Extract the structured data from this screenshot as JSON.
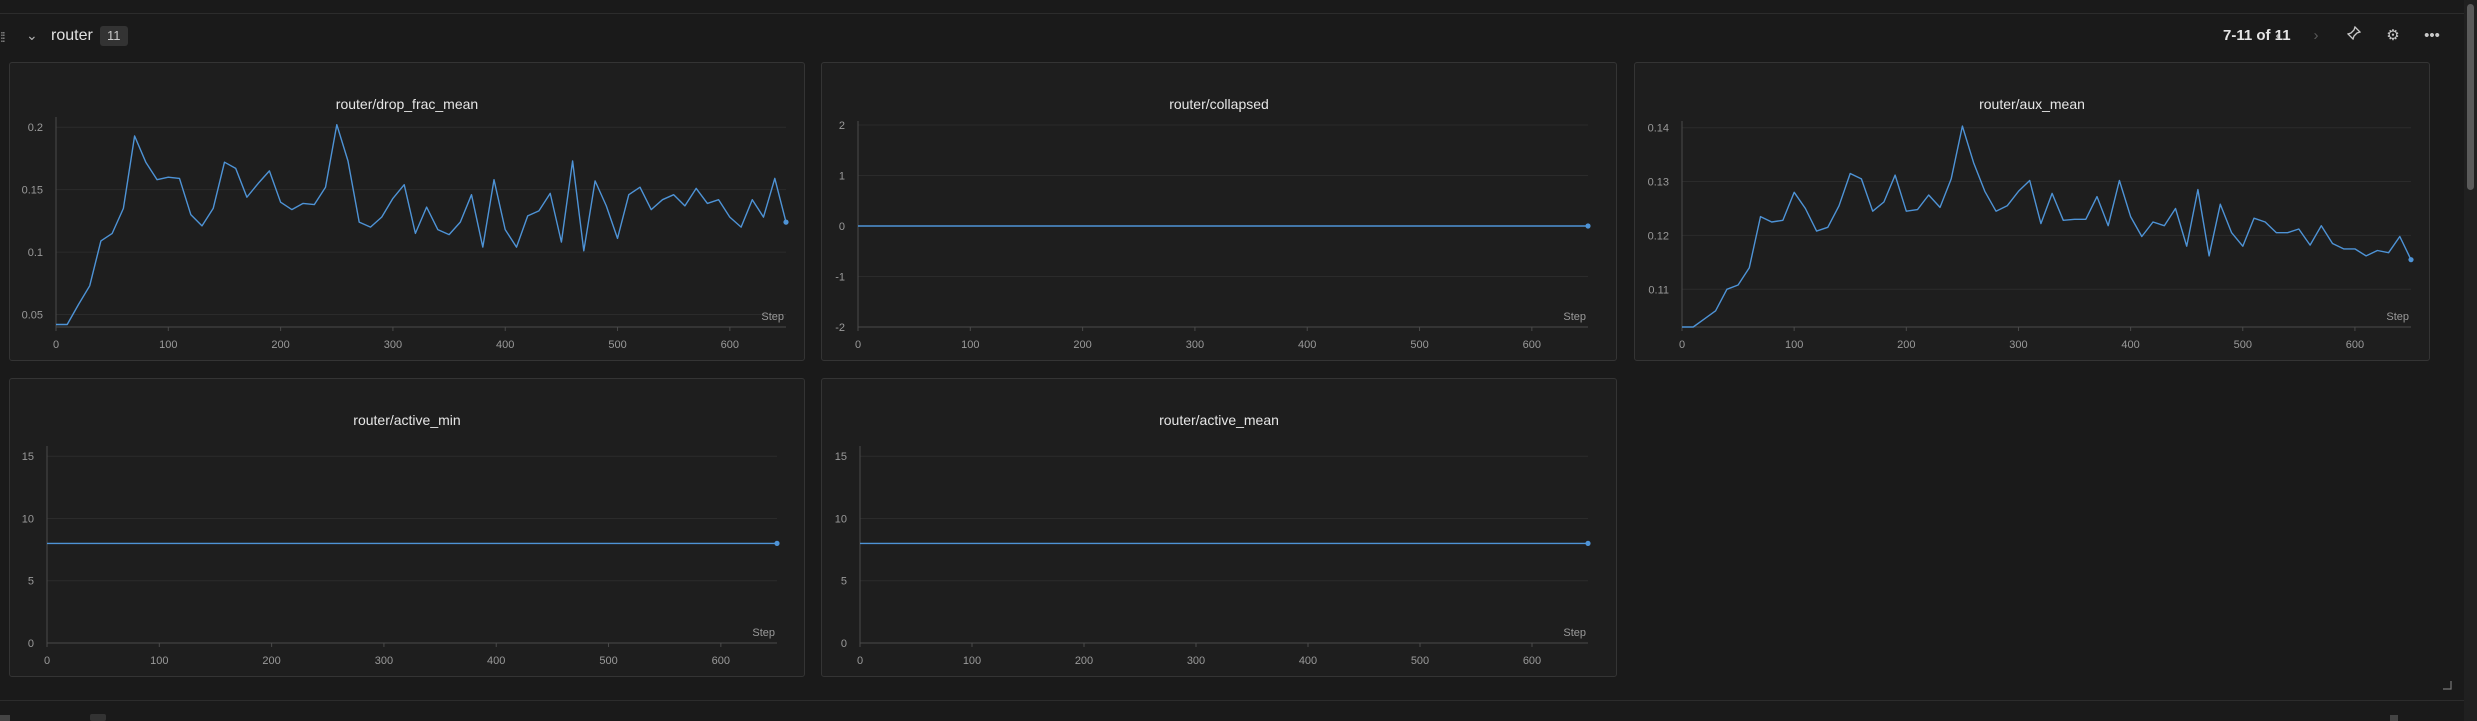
{
  "section": {
    "title": "router",
    "count": "11",
    "pager": "7-11 of 11"
  },
  "icons": {
    "drag": "drag-handle-icon",
    "collapse": "chevron-down-icon",
    "prev": "chevron-left-icon",
    "next": "chevron-right-icon",
    "pin": "pin-icon",
    "settings": "gear-icon",
    "more": "more-horizontal-icon",
    "resize": "resize-corner-icon"
  },
  "colors": {
    "line": "#4e93d6",
    "background": "#1a1a1a",
    "panel": "#1e1e1e",
    "grid": "#2b2b2b"
  },
  "chart_data": [
    {
      "type": "line",
      "title": "router/drop_frac_mean",
      "xlabel": "Step",
      "xlim": [
        0,
        650
      ],
      "ylim": [
        0.04,
        0.205
      ],
      "xticks": [
        0,
        100,
        200,
        300,
        400,
        500,
        600
      ],
      "yticks": [
        0.05,
        0.1,
        0.15,
        0.2
      ],
      "ytick_labels": [
        "0.05",
        "0.1",
        "0.15",
        "0.2"
      ],
      "grid": true,
      "end_marker": true,
      "x": [
        0,
        10,
        20,
        30,
        40,
        50,
        60,
        70,
        80,
        90,
        100,
        110,
        120,
        130,
        140,
        150,
        160,
        170,
        180,
        190,
        200,
        210,
        220,
        230,
        240,
        250,
        260,
        270,
        280,
        290,
        300,
        310,
        320,
        330,
        340,
        350,
        360,
        370,
        380,
        390,
        400,
        410,
        420,
        430,
        440,
        450,
        460,
        470,
        480,
        490,
        500,
        510,
        520,
        530,
        540,
        550,
        560,
        570,
        580,
        590,
        600,
        610,
        620,
        630,
        640,
        650
      ],
      "y": [
        0.042,
        0.042,
        0.058,
        0.073,
        0.109,
        0.115,
        0.135,
        0.193,
        0.172,
        0.158,
        0.16,
        0.159,
        0.13,
        0.121,
        0.135,
        0.172,
        0.167,
        0.144,
        0.155,
        0.165,
        0.14,
        0.134,
        0.139,
        0.138,
        0.152,
        0.202,
        0.173,
        0.124,
        0.12,
        0.128,
        0.143,
        0.154,
        0.115,
        0.136,
        0.118,
        0.114,
        0.124,
        0.146,
        0.104,
        0.158,
        0.118,
        0.104,
        0.129,
        0.133,
        0.147,
        0.108,
        0.173,
        0.101,
        0.157,
        0.137,
        0.111,
        0.146,
        0.152,
        0.134,
        0.142,
        0.146,
        0.137,
        0.151,
        0.139,
        0.142,
        0.128,
        0.12,
        0.142,
        0.128,
        0.159,
        0.124
      ]
    },
    {
      "type": "line",
      "title": "router/collapsed",
      "xlabel": "Step",
      "xlim": [
        0,
        650
      ],
      "ylim": [
        -2,
        2
      ],
      "xticks": [
        0,
        100,
        200,
        300,
        400,
        500,
        600
      ],
      "yticks": [
        -2,
        -1,
        0,
        1,
        2
      ],
      "ytick_labels": [
        "-2",
        "-1",
        "0",
        "1",
        "2"
      ],
      "grid": true,
      "end_marker": true,
      "x": [
        0,
        650
      ],
      "y": [
        0,
        0
      ]
    },
    {
      "type": "line",
      "title": "router/aux_mean",
      "xlabel": "Step",
      "xlim": [
        0,
        650
      ],
      "ylim": [
        0.103,
        0.1405
      ],
      "xticks": [
        0,
        100,
        200,
        300,
        400,
        500,
        600
      ],
      "yticks": [
        0.11,
        0.12,
        0.13,
        0.14
      ],
      "ytick_labels": [
        "0.11",
        "0.12",
        "0.13",
        "0.14"
      ],
      "grid": true,
      "end_marker": true,
      "x": [
        0,
        10,
        20,
        30,
        40,
        50,
        60,
        70,
        80,
        90,
        100,
        110,
        120,
        130,
        140,
        150,
        160,
        170,
        180,
        190,
        200,
        210,
        220,
        230,
        240,
        250,
        260,
        270,
        280,
        290,
        300,
        310,
        320,
        330,
        340,
        350,
        360,
        370,
        380,
        390,
        400,
        410,
        420,
        430,
        440,
        450,
        460,
        470,
        480,
        490,
        500,
        510,
        520,
        530,
        540,
        550,
        560,
        570,
        580,
        590,
        600,
        610,
        620,
        630,
        640,
        650
      ],
      "y": [
        0.103,
        0.103,
        0.1045,
        0.106,
        0.11,
        0.1108,
        0.114,
        0.1235,
        0.1225,
        0.1228,
        0.128,
        0.125,
        0.1208,
        0.1215,
        0.1255,
        0.1315,
        0.1305,
        0.1245,
        0.1262,
        0.1312,
        0.1245,
        0.1248,
        0.1275,
        0.1252,
        0.1305,
        0.1403,
        0.1335,
        0.1282,
        0.1245,
        0.1255,
        0.1282,
        0.1302,
        0.1222,
        0.1278,
        0.1228,
        0.123,
        0.123,
        0.1272,
        0.1218,
        0.1302,
        0.1235,
        0.1198,
        0.1225,
        0.1218,
        0.125,
        0.118,
        0.1285,
        0.1162,
        0.1258,
        0.1205,
        0.118,
        0.1232,
        0.1225,
        0.1205,
        0.1205,
        0.1212,
        0.1182,
        0.1218,
        0.1185,
        0.1175,
        0.1175,
        0.1162,
        0.1172,
        0.1168,
        0.1198,
        0.1155
      ]
    },
    {
      "type": "line",
      "title": "router/active_min",
      "xlabel": "Step",
      "xlim": [
        0,
        650
      ],
      "ylim": [
        0,
        15.5
      ],
      "xticks": [
        0,
        100,
        200,
        300,
        400,
        500,
        600
      ],
      "yticks": [
        0,
        5,
        10,
        15
      ],
      "ytick_labels": [
        "0",
        "5",
        "10",
        "15"
      ],
      "grid": true,
      "end_marker": true,
      "x": [
        0,
        650
      ],
      "y": [
        8,
        8
      ]
    },
    {
      "type": "line",
      "title": "router/active_mean",
      "xlabel": "Step",
      "xlim": [
        0,
        650
      ],
      "ylim": [
        0,
        15.5
      ],
      "xticks": [
        0,
        100,
        200,
        300,
        400,
        500,
        600
      ],
      "yticks": [
        0,
        5,
        10,
        15
      ],
      "ytick_labels": [
        "0",
        "5",
        "10",
        "15"
      ],
      "grid": true,
      "end_marker": true,
      "x": [
        0,
        650
      ],
      "y": [
        8,
        8
      ]
    }
  ]
}
